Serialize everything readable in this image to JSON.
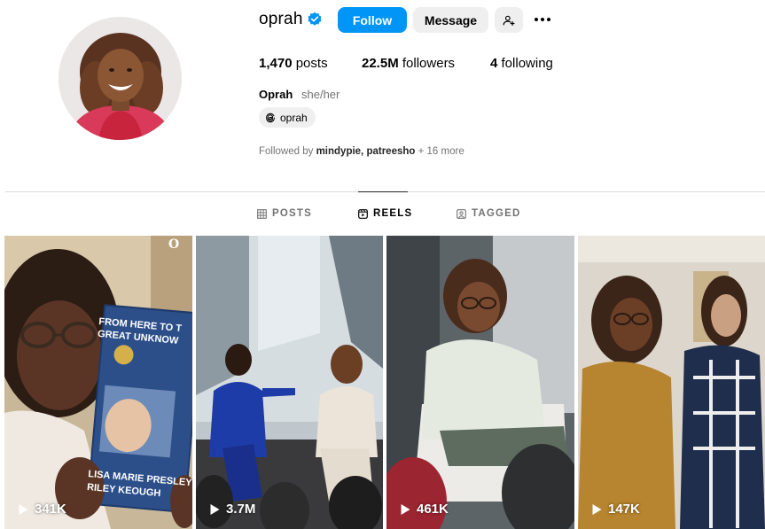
{
  "profile": {
    "username": "oprah",
    "verified": true,
    "follow_label": "Follow",
    "message_label": "Message",
    "add_user_icon": "add-user-icon",
    "more_icon": "more-options-icon",
    "posts_count": "1,470",
    "posts_label": "posts",
    "followers_count": "22.5M",
    "followers_label": "followers",
    "following_count": "4",
    "following_label": "following",
    "full_name": "Oprah",
    "pronouns": "she/her",
    "threads_handle": "oprah",
    "followed_by_prefix": "Followed by",
    "followed_by_users": "mindypie, patreesho",
    "followed_by_more": "+ 16 more"
  },
  "tabs": [
    {
      "label": "POSTS",
      "icon": "grid-icon",
      "active": false
    },
    {
      "label": "REELS",
      "icon": "reels-icon",
      "active": true
    },
    {
      "label": "TAGGED",
      "icon": "tagged-icon",
      "active": false
    }
  ],
  "reels": [
    {
      "views": "341K",
      "book_title_line1": "FROM HERE TO T",
      "book_title_line2": "GREAT UNKNOW",
      "book_author_line1": "LISA MARIE PRESLEY",
      "book_author_line2": "RILEY KEOUGH",
      "book_logo": "O"
    },
    {
      "views": "3.7M"
    },
    {
      "views": "461K"
    },
    {
      "views": "147K"
    }
  ],
  "colors": {
    "primary_blue": "#0095f6",
    "button_gray": "#efefef",
    "muted_text": "#737373",
    "divider": "#dbdbdb"
  }
}
